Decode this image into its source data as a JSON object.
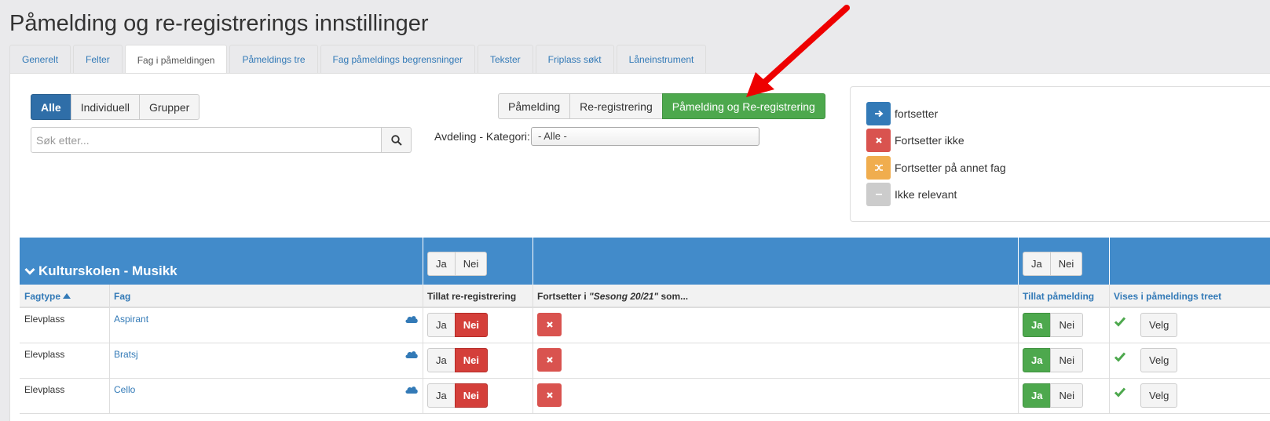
{
  "page_title": "Påmelding og re-registrerings innstillinger",
  "tabs": [
    "Generelt",
    "Felter",
    "Fag i påmeldingen",
    "Påmeldings tre",
    "Fag påmeldings begrensninger",
    "Tekster",
    "Friplass søkt",
    "Låneinstrument"
  ],
  "active_tab": "Fag i påmeldingen",
  "filter_type": [
    "Alle",
    "Individuell",
    "Grupper"
  ],
  "mode": [
    "Påmelding",
    "Re-registrering",
    "Påmelding og Re-registrering"
  ],
  "search": {
    "placeholder": "Søk etter..."
  },
  "department": {
    "label": "Avdeling - Kategori:",
    "value": "- Alle -"
  },
  "legend": [
    {
      "text": "fortsetter",
      "color": "#337ab7",
      "icon": "arrow-right-icon"
    },
    {
      "text": "Fortsetter ikke",
      "color": "#d9534f",
      "icon": "close-icon"
    },
    {
      "text": "Fortsetter på annet fag",
      "color": "#f0ad4e",
      "icon": "shuffle-icon"
    },
    {
      "text": "Ikke relevant",
      "color": "#cccccc",
      "icon": "minus-icon"
    }
  ],
  "grid": {
    "group_title": "Kulturskolen - Musikk",
    "ja": "Ja",
    "nei": "Nei",
    "velg": "Velg",
    "columns": {
      "fagtype": "Fagtype",
      "fag": "Fag",
      "tillat_rereg": "Tillat re-registrering",
      "fortsetter_prefix": "Fortsetter i ",
      "fortsetter_season": "\"Sesong 20/21\"",
      "fortsetter_suffix": " som...",
      "tillat_pamelding": "Tillat påmelding",
      "vises": "Vises i påmeldings treet"
    },
    "rows": [
      {
        "fagtype": "Elevplass",
        "fag": "Aspirant"
      },
      {
        "fagtype": "Elevplass",
        "fag": "Bratsj"
      },
      {
        "fagtype": "Elevplass",
        "fag": "Cello"
      }
    ]
  }
}
